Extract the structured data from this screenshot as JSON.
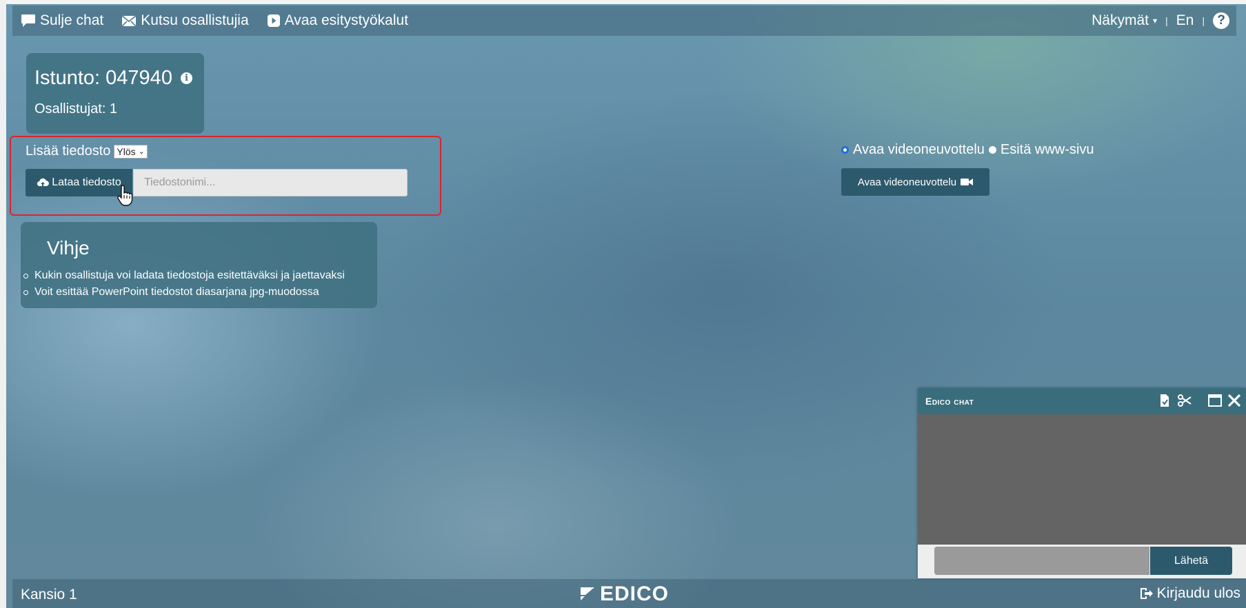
{
  "topbar": {
    "close_chat": "Sulje chat",
    "invite": "Kutsu osallistujia",
    "open_tools": "Avaa esitystyökalut",
    "views": "Näkymät",
    "language": "En",
    "help": "?"
  },
  "session": {
    "title": "Istunto: 047940",
    "participants": "Osallistujat: 1"
  },
  "upload": {
    "label": "Lisää tiedosto",
    "select_value": "Ylös",
    "button": "Lataa tiedosto",
    "filename_placeholder": "Tiedostonimi..."
  },
  "hint": {
    "title": "Vihje",
    "items": [
      "Kukin osallistuja voi ladata tiedostoja esitettäväksi ja jaettavaksi",
      "Voit esittää PowerPoint tiedostot diasarjana jpg-muodossa"
    ]
  },
  "video": {
    "radio_1": "Avaa videoneuvottelu",
    "radio_2": "Esitä www-sivu",
    "radio_selected": "Avaa videoneuvottelu",
    "button": "Avaa videoneuvottelu"
  },
  "chat": {
    "title": "Edico chat",
    "send": "Lähetä"
  },
  "footer": {
    "folder": "Kansio 1",
    "logo_text": "EDICO",
    "logout": "Kirjaudu ulos"
  },
  "colors": {
    "accent": "#2c5a6c",
    "highlight_border": "#d9252e",
    "panel": "#3e7080"
  },
  "icons": [
    "comment-icon",
    "envelope-icon",
    "play-icon",
    "info-icon",
    "cloud-upload-icon",
    "video-camera-icon",
    "document-check-icon",
    "scissors-icon",
    "maximize-icon",
    "close-icon",
    "logout-icon",
    "edico-logo-icon",
    "help-icon"
  ]
}
